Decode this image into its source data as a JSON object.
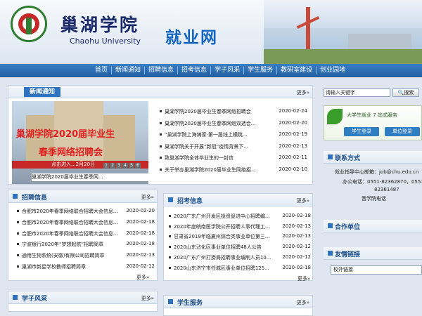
{
  "header": {
    "school_name": "巢湖学院",
    "school_en": "Chaohu University",
    "site_name": "就业网"
  },
  "nav": [
    "首页",
    "新闻通知",
    "招聘信息",
    "招考信息",
    "学子风采",
    "学生服务",
    "教研室建设",
    "创业园地"
  ],
  "news": {
    "title": "新闻通知",
    "more": "更多»",
    "photo_headline1": "巢湖学院2020届毕业生",
    "photo_headline2": "春季网络招聘会",
    "photo_strip": "点击进入...2月20日",
    "caption": "巢湖学院2020届毕业生春季网...",
    "thumbs": [
      "1",
      "2",
      "3",
      "4",
      "5",
      "6"
    ],
    "items": [
      {
        "title": "巢湖学院2020届毕业生春季网络招聘会",
        "date": "2020-02-24"
      },
      {
        "title": "巢湖学院2020届毕业生春季网络双选会...",
        "date": "2020-02-20"
      },
      {
        "title": "“巢湖学院上海铸家·第一届线上横跳...",
        "date": "2020-02-19"
      },
      {
        "title": "巢湖学院关于开展“新冠”疫情背景下...",
        "date": "2020-02-13"
      },
      {
        "title": "致巢湖学院全体毕业生的一封信",
        "date": "2020-02-11"
      },
      {
        "title": "关于举办巢湖学院2020届毕业生网络招...",
        "date": "2020-02-10"
      }
    ]
  },
  "recruit": {
    "title": "招聘信息",
    "more": "更多»",
    "items": [
      {
        "title": "合肥市2020年春季网络联合招聘大会信息...",
        "date": "2020-02-20"
      },
      {
        "title": "合肥市2020年春季网络联合招聘大会信息...",
        "date": "2020-02-18"
      },
      {
        "title": "合肥市2020年春季网络联合招聘大会信息...",
        "date": "2020-02-18"
      },
      {
        "title": "宁波银行2020年“梦想起航”招聘简章",
        "date": "2020-02-18"
      },
      {
        "title": "通用生物系统(安徽)有限公司招聘简章",
        "date": "2020-02-13"
      },
      {
        "title": "巢湖市新星学校教师招聘简章",
        "date": "2020-02-12"
      }
    ]
  },
  "exam": {
    "title": "招考信息",
    "more": "更多»",
    "items": [
      {
        "title": "2020广东广州开发区投资促进中心招聘编...",
        "date": "2020-02-18"
      },
      {
        "title": "2020年度皖南医学院公开招聘人事代理工...",
        "date": "2020-02-13"
      },
      {
        "title": "甘肃省2019年临夏州综合类事业单位第三...",
        "date": "2020-02-13"
      },
      {
        "title": "2020山东沾化区事业单位招聘48人公告",
        "date": "2020-02-12"
      },
      {
        "title": "2020广东广州打捞局招聘事业编制人员10...",
        "date": "2020-02-12"
      },
      {
        "title": "2020山东济宁市任城区事业单位招聘125...",
        "date": "2020-02-18"
      }
    ]
  },
  "students": {
    "title": "学子风采",
    "more": "更多»"
  },
  "services": {
    "title": "学生服务",
    "more": "更多»"
  },
  "search": {
    "placeholder": "请输入关键字",
    "button": "搜索"
  },
  "banner": {
    "text": "大学生就业 7 站式服务",
    "login1": "学生登录",
    "login2": "单位登录"
  },
  "contact": {
    "title": "联系方式",
    "lines": [
      "就业指导中心邮箱：job@chu.edu.cn",
      "办公电话：0551-82362870，0551-",
      "82361487",
      "音学院电话"
    ]
  },
  "unit": {
    "title": "合作单位"
  },
  "links": {
    "title": "友情链接",
    "select_label": "校外链接"
  },
  "colors": {
    "nav_bg": "#2566ad",
    "accent": "#2f73bf",
    "headline": "#e02020"
  }
}
